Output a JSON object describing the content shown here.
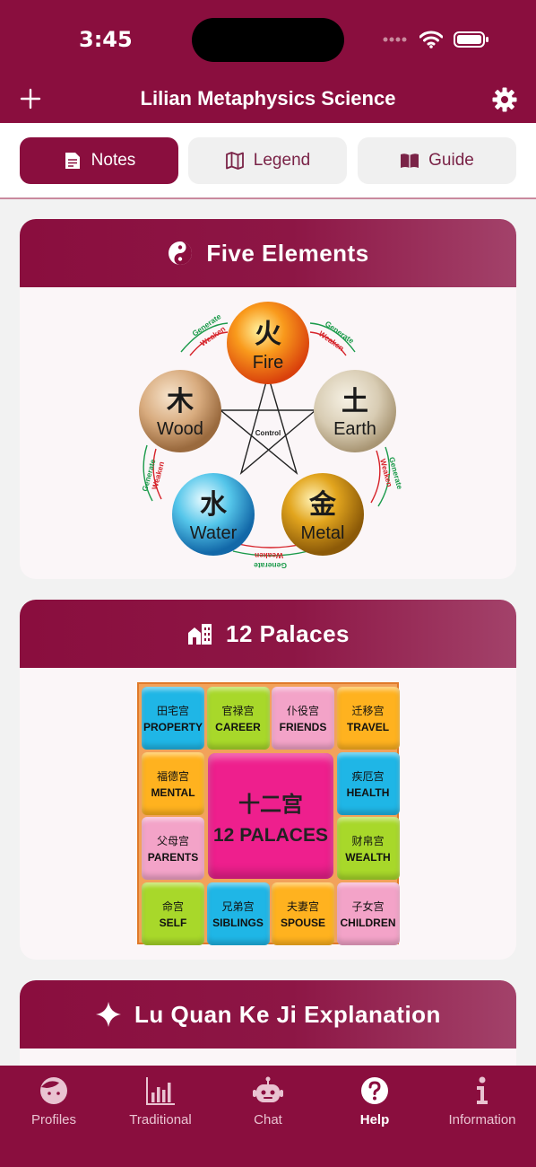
{
  "status": {
    "time": "3:45"
  },
  "nav": {
    "title": "Lilian Metaphysics Science",
    "add_icon": "plus-icon",
    "settings_icon": "gear-icon"
  },
  "segments": [
    {
      "label": "Notes",
      "icon": "note-icon",
      "active": true
    },
    {
      "label": "Legend",
      "icon": "map-icon",
      "active": false
    },
    {
      "label": "Guide",
      "icon": "book-icon",
      "active": false
    }
  ],
  "cards": [
    {
      "title": "Five Elements",
      "icon": "yin-yang-icon"
    },
    {
      "title": "12 Palaces",
      "icon": "buildings-icon"
    },
    {
      "title": "Lu Quan Ke Ji Explanation",
      "icon": "sparkle-icon"
    }
  ],
  "five_elements": {
    "fire": {
      "cn": "火",
      "en": "Fire"
    },
    "earth": {
      "cn": "土",
      "en": "Earth"
    },
    "metal": {
      "cn": "金",
      "en": "Metal"
    },
    "water": {
      "cn": "水",
      "en": "Water"
    },
    "wood": {
      "cn": "木",
      "en": "Wood"
    },
    "generate": "Generate",
    "weaken": "Weaken",
    "control": "Control"
  },
  "palaces": {
    "center_cn": "十二宫",
    "center_en": "12 PALACES",
    "cells": [
      {
        "cn": "田宅宫",
        "en": "PROPERTY",
        "color": "#1fb6e6"
      },
      {
        "cn": "官禄宫",
        "en": "CAREER",
        "color": "#a8d82a"
      },
      {
        "cn": "仆役宫",
        "en": "FRIENDS",
        "color": "#f3a3c8"
      },
      {
        "cn": "迁移宫",
        "en": "TRAVEL",
        "color": "#ffb21f"
      },
      {
        "cn": "福德宫",
        "en": "MENTAL",
        "color": "#ffb21f"
      },
      {
        "cn": "疾厄宫",
        "en": "HEALTH",
        "color": "#1fb6e6"
      },
      {
        "cn": "父母宫",
        "en": "PARENTS",
        "color": "#f3a3c8"
      },
      {
        "cn": "财帛宫",
        "en": "WEALTH",
        "color": "#a8d82a"
      },
      {
        "cn": "命宫",
        "en": "SELF",
        "color": "#a8d82a"
      },
      {
        "cn": "兄弟宫",
        "en": "SIBLINGS",
        "color": "#1fb6e6"
      },
      {
        "cn": "夫妻宫",
        "en": "SPOUSE",
        "color": "#ffb21f"
      },
      {
        "cn": "子女宫",
        "en": "CHILDREN",
        "color": "#f3a3c8"
      }
    ]
  },
  "tabs": [
    {
      "label": "Profiles",
      "icon": "face-icon",
      "active": false
    },
    {
      "label": "Traditional",
      "icon": "bar-chart-icon",
      "active": false
    },
    {
      "label": "Chat",
      "icon": "robot-icon",
      "active": false
    },
    {
      "label": "Help",
      "icon": "question-icon",
      "active": true
    },
    {
      "label": "Information",
      "icon": "info-icon",
      "active": false
    }
  ],
  "colors": {
    "brand": "#8a0e3e",
    "card_bg": "#fbf6f8"
  }
}
